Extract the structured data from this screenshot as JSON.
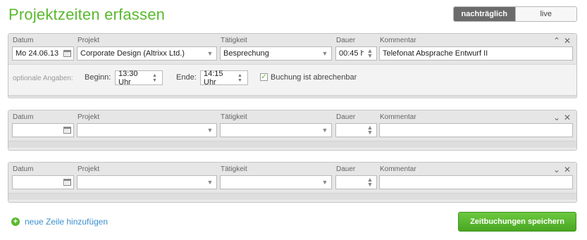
{
  "page": {
    "title": "Projektzeiten erfassen",
    "mode_toggle": {
      "options": [
        "nachträglich",
        "live"
      ],
      "active": "nachträglich"
    }
  },
  "labels": {
    "datum": "Datum",
    "projekt": "Projekt",
    "taetigkeit": "Tätigkeit",
    "dauer": "Dauer",
    "kommentar": "Kommentar"
  },
  "entries": [
    {
      "expanded": true,
      "datum": "Mo 24.06.13",
      "projekt": "Corporate Design (Altrixx Ltd.)",
      "taetigkeit": "Besprechung",
      "dauer": "00:45 h",
      "kommentar": "Telefonat Absprache Entwurf II",
      "optional": {
        "label": "optionale Angaben:",
        "beginn_label": "Beginn:",
        "beginn": "13:30 Uhr",
        "ende_label": "Ende:",
        "ende": "14:15 Uhr",
        "billable_label": "Buchung ist abrechenbar",
        "billable": true
      }
    },
    {
      "expanded": false,
      "datum": "",
      "projekt": "",
      "taetigkeit": "",
      "dauer": "",
      "kommentar": ""
    },
    {
      "expanded": false,
      "datum": "",
      "projekt": "",
      "taetigkeit": "",
      "dauer": "",
      "kommentar": ""
    }
  ],
  "actions": {
    "add_row": "neue Zeile hinzufügen",
    "save": "Zeitbuchungen speichern"
  },
  "colors": {
    "accent": "#5ab82e",
    "link": "#3b8fcf"
  }
}
